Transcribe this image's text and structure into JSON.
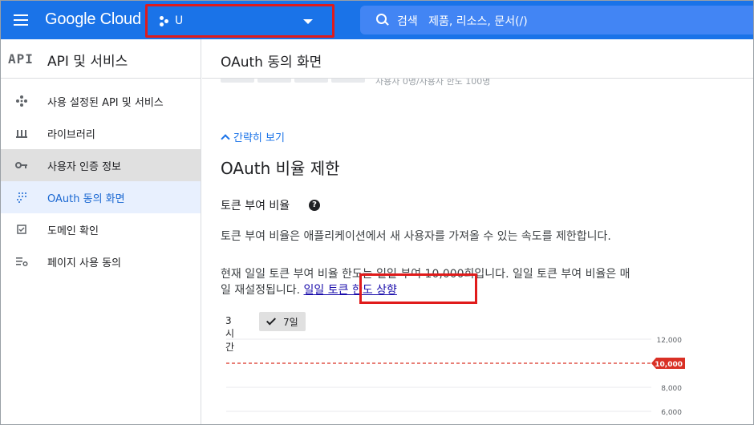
{
  "topbar": {
    "brand": "Google Cloud",
    "project_name": "U",
    "search_label": "검색",
    "search_placeholder": "제품, 리소스, 문서(/)"
  },
  "sidebar": {
    "logo_text": "API",
    "title": "API 및 서비스",
    "items": [
      {
        "label": "사용 설정된 API 및 서비스",
        "icon": "api-diamond-icon"
      },
      {
        "label": "라이브러리",
        "icon": "library-icon"
      },
      {
        "label": "사용자 인증 정보",
        "icon": "key-icon"
      },
      {
        "label": "OAuth 동의 화면",
        "icon": "consent-grid-icon"
      },
      {
        "label": "도메인 확인",
        "icon": "checkbox-icon"
      },
      {
        "label": "페이지 사용 동의",
        "icon": "settings-list-icon"
      }
    ]
  },
  "main": {
    "page_title": "OAuth 동의 화면",
    "partial_text": "사용자 0명/사용자 한도 100명",
    "collapse_label": "간략히 보기",
    "section_title": "OAuth 비율 제한",
    "subsection_title": "토큰 부여 비율",
    "description": "토큰 부여 비율은 애플리케이션에서 새 사용자를 가져올 수 있는 속도를 제한합니다.",
    "daily_limit_text": "현재 일일 토큰 부여 비율 한도는 일일 부여 10,000회입니다. 일일 토큰 부여 비율은 매일 재설정됩니다.",
    "quota_link": "일일 토큰 한도 상향",
    "range_3h": "3시간",
    "range_7d": "7일"
  },
  "chart_data": {
    "type": "line",
    "ylim": [
      5000,
      12000
    ],
    "y_ticks": [
      "12,000",
      "8,000",
      "6,000"
    ],
    "limit_line": {
      "value": 10000,
      "label": "10,000",
      "color": "#d93025"
    }
  }
}
